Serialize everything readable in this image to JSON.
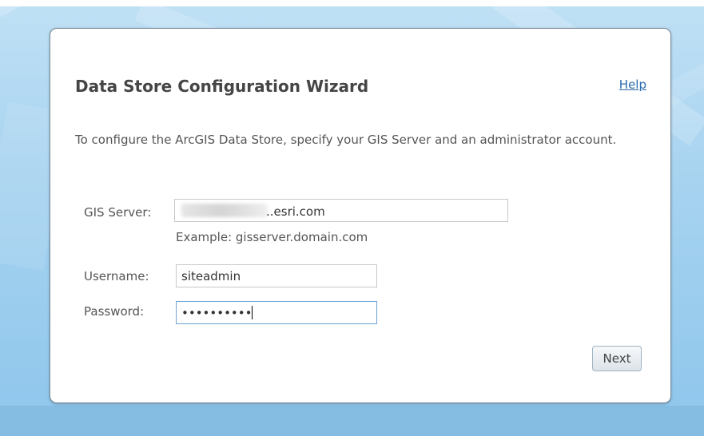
{
  "wizard": {
    "title": "Data Store Configuration Wizard",
    "help_link": "Help",
    "intro": "To configure the ArcGIS Data Store, specify your GIS Server and an administrator account."
  },
  "form": {
    "gis_server": {
      "label": "GIS Server:",
      "value_suffix": "..esri.com",
      "example": "Example: gisserver.domain.com"
    },
    "username": {
      "label": "Username:",
      "value": "siteadmin"
    },
    "password": {
      "label": "Password:",
      "value": "••••••••••"
    }
  },
  "buttons": {
    "next": "Next"
  }
}
